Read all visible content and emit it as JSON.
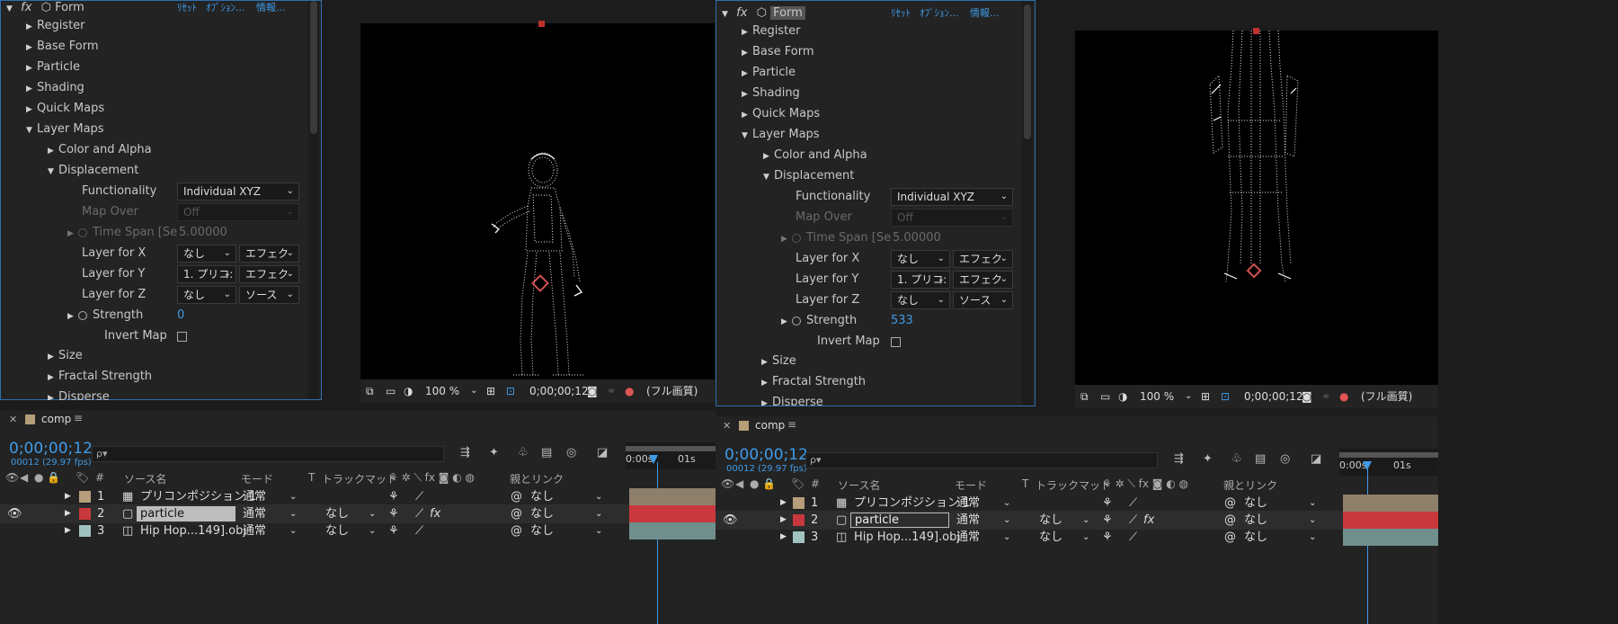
{
  "left": {
    "effect": {
      "fx": "fx",
      "name": "Form",
      "reset": "ﾘｾｯﾄ",
      "options": "ｵﾌﾟｼｮﾝ...",
      "info": "情報..."
    },
    "groups": [
      {
        "label": "Register",
        "open": false
      },
      {
        "label": "Base Form",
        "open": false
      },
      {
        "label": "Particle",
        "open": false
      },
      {
        "label": "Shading",
        "open": false
      },
      {
        "label": "Quick Maps",
        "open": false
      },
      {
        "label": "Layer Maps",
        "open": true
      }
    ],
    "sub": {
      "color_alpha": "Color and Alpha",
      "displacement": "Displacement"
    },
    "props": {
      "functionality": {
        "label": "Functionality",
        "value": "Individual XYZ"
      },
      "map_over": {
        "label": "Map Over",
        "value": "Off"
      },
      "time_span": {
        "label": "Time Span [Se",
        "value": "5.00000"
      },
      "layer_x": {
        "label": "Layer for X",
        "value": "なし",
        "mode": "エフェク"
      },
      "layer_y": {
        "label": "Layer for Y",
        "value": "1. プリコ:",
        "mode": "エフェク"
      },
      "layer_z": {
        "label": "Layer for Z",
        "value": "なし",
        "mode": "ソース"
      },
      "strength": {
        "label": "Strength",
        "value": "0"
      },
      "invert": {
        "label": "Invert Map"
      }
    },
    "more": {
      "size": "Size",
      "fractal": "Fractal Strength",
      "disperse": "Disperse"
    },
    "viewer": {
      "zoom": "100 %",
      "timecode": "0;00;00;12",
      "quality": "(フル画質)"
    },
    "timeline": {
      "tab": "comp",
      "timecode": "0;00;00;12",
      "fps": "00012 (29.97 fps)",
      "search_placeholder": "ρ▾",
      "headers": {
        "num": "#",
        "source": "ソース名",
        "mode": "モード",
        "t": "T",
        "track": "トラックマット",
        "parent": "親とリンク"
      },
      "ruler": {
        "start": "0:00s",
        "one": "01s"
      },
      "layers": [
        {
          "num": "1",
          "name": "プリコンポジション 1",
          "mode": "通常",
          "track": "",
          "parent": "なし",
          "color": "#b59e79"
        },
        {
          "num": "2",
          "name": "particle",
          "mode": "通常",
          "track": "なし",
          "parent": "なし",
          "color": "#c8383d"
        },
        {
          "num": "3",
          "name": "Hip Hop...149].obj",
          "mode": "通常",
          "track": "なし",
          "parent": "なし",
          "color": "#9fc4bf"
        }
      ]
    }
  },
  "right": {
    "effect": {
      "fx": "fx",
      "name": "Form",
      "reset": "ﾘｾｯﾄ",
      "options": "ｵﾌﾟｼｮﾝ...",
      "info": "情報..."
    },
    "groups": [
      {
        "label": "Register",
        "open": false
      },
      {
        "label": "Base Form",
        "open": false
      },
      {
        "label": "Particle",
        "open": false
      },
      {
        "label": "Shading",
        "open": false
      },
      {
        "label": "Quick Maps",
        "open": false
      },
      {
        "label": "Layer Maps",
        "open": true
      }
    ],
    "sub": {
      "color_alpha": "Color and Alpha",
      "displacement": "Displacement"
    },
    "props": {
      "functionality": {
        "label": "Functionality",
        "value": "Individual XYZ"
      },
      "map_over": {
        "label": "Map Over",
        "value": "Off"
      },
      "time_span": {
        "label": "Time Span [Se",
        "value": "5.00000"
      },
      "layer_x": {
        "label": "Layer for X",
        "value": "なし",
        "mode": "エフェク"
      },
      "layer_y": {
        "label": "Layer for Y",
        "value": "1. プリコ:",
        "mode": "エフェク"
      },
      "layer_z": {
        "label": "Layer for Z",
        "value": "なし",
        "mode": "ソース"
      },
      "strength": {
        "label": "Strength",
        "value": "533"
      },
      "invert": {
        "label": "Invert Map"
      }
    },
    "more": {
      "size": "Size",
      "fractal": "Fractal Strength",
      "disperse": "Disperse"
    },
    "viewer": {
      "zoom": "100 %",
      "timecode": "0;00;00;12",
      "quality": "(フル画質)"
    },
    "timeline": {
      "tab": "comp",
      "timecode": "0;00;00;12",
      "fps": "00012 (29.97 fps)",
      "search_placeholder": "ρ▾",
      "headers": {
        "num": "#",
        "source": "ソース名",
        "mode": "モード",
        "t": "T",
        "track": "トラックマット",
        "parent": "親とリンク"
      },
      "ruler": {
        "start": "0:00s",
        "one": "01s"
      },
      "layers": [
        {
          "num": "1",
          "name": "プリコンポジション 1",
          "mode": "通常",
          "track": "",
          "parent": "なし",
          "color": "#b59e79"
        },
        {
          "num": "2",
          "name": "particle",
          "mode": "通常",
          "track": "なし",
          "parent": "なし",
          "color": "#c8383d"
        },
        {
          "num": "3",
          "name": "Hip Hop...149].obj",
          "mode": "通常",
          "track": "なし",
          "parent": "なし",
          "color": "#9fc4bf"
        }
      ]
    }
  },
  "colors": {
    "accent": "#3f9be8",
    "panel": "#232323",
    "viewer_bg": "#000000",
    "track_red": "#c8383d",
    "track_tan": "#8d7f6a",
    "track_teal": "#6f8f8c"
  }
}
